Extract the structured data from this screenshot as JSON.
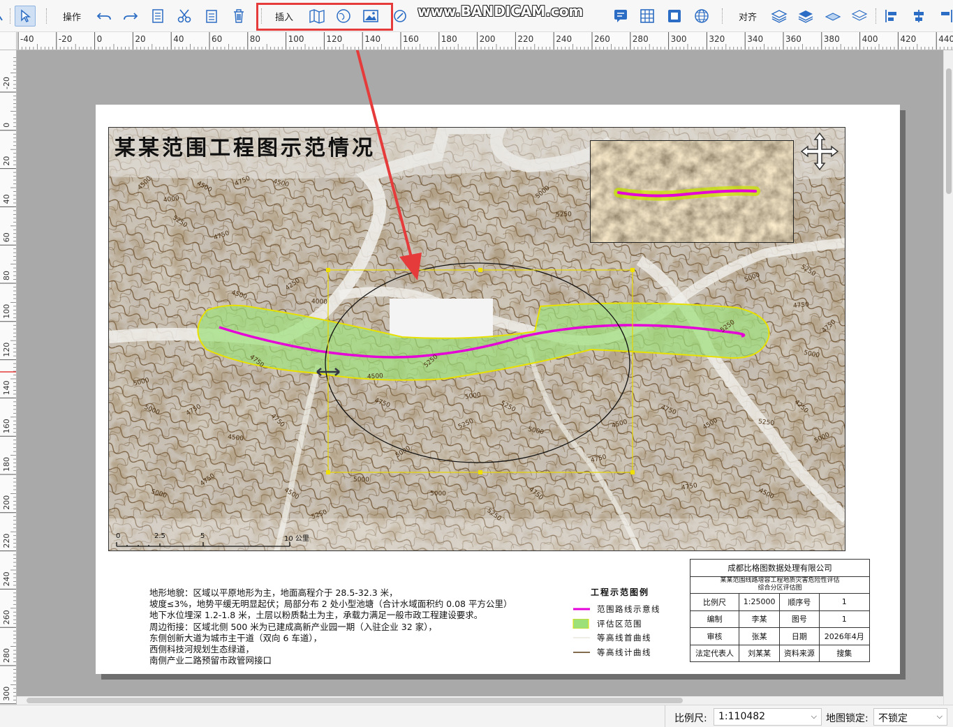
{
  "toolbar": {
    "operate_label": "操作",
    "insert_label": "插入",
    "align_label": "对齐",
    "watermark": "www.BANDICAM.com"
  },
  "ruler": {
    "h_labels": [
      "-40",
      "-20",
      "0",
      "20",
      "40",
      "60",
      "80",
      "100",
      "120",
      "140",
      "160",
      "180",
      "200",
      "220",
      "240",
      "260",
      "280",
      "300",
      "320",
      "340",
      "360",
      "380",
      "400",
      "420",
      "440"
    ],
    "v_labels": [
      "-20",
      "0",
      "20",
      "40",
      "60",
      "80",
      "100",
      "120",
      "140",
      "160",
      "180",
      "200",
      "220",
      "240",
      "260",
      "280",
      "300"
    ]
  },
  "map": {
    "title": "某某范围工程图示范情况",
    "contour_labels": [
      "4500",
      "4750",
      "5000",
      "5250",
      "4250",
      "4000",
      "3750"
    ],
    "scalebar": {
      "ticks": [
        "0",
        "2.5",
        "5",
        "10 公里"
      ]
    }
  },
  "description": {
    "lines": [
      "地形地貌：区域以平原地形为主，地面高程介于 28.5-32.3 米，",
      "坡度≤3%，地势平缓无明显起伏；局部分布 2 处小型池塘（合计水域面积约 0.08 平方公里）",
      "地下水位埋深 1.2-1.8 米，土层以粉质黏土为主，承载力满足一般市政工程建设要求。",
      "周边衔接：区域北侧 500 米为已建成高新产业园一期（入驻企业 32 家），",
      "东侧创新大道为城市主干道（双向 6 车道），",
      "西侧科技河规划生态绿道，",
      "南侧产业二路预留市政管网接口"
    ]
  },
  "legend": {
    "title": "工程示范图例",
    "items": [
      {
        "label": "范围路线示意线",
        "color": "#e600d8"
      },
      {
        "label": "评估区范围",
        "color": "#9de07a"
      },
      {
        "label": "等高线首曲线",
        "color": "#e8e2d6"
      },
      {
        "label": "等高线计曲线",
        "color": "#5a3a14"
      }
    ]
  },
  "title_block": {
    "company": "成都比格图数据处理有限公司",
    "project_line1": "某某范围线路增容工程地质灾害危险性评估",
    "project_line2": "综合分区评估图",
    "rows": [
      [
        "比例尺",
        "1:25000",
        "顺序号",
        "1"
      ],
      [
        "编制",
        "李某",
        "图号",
        "1"
      ],
      [
        "审核",
        "张某",
        "日期",
        "2026年4月"
      ],
      [
        "法定代表人",
        "刘某某",
        "资料来源",
        "搜集"
      ]
    ]
  },
  "statusbar": {
    "scale_label": "比例尺:",
    "scale_value": "1:110482",
    "lock_label": "地图锁定:",
    "lock_value": "不锁定"
  },
  "colors": {
    "route": "#e600d8",
    "zone_fill": "#9de07a",
    "zone_stroke": "#e8e000",
    "selection": "#e8d800",
    "annotation_arrow": "#e53b3b"
  }
}
